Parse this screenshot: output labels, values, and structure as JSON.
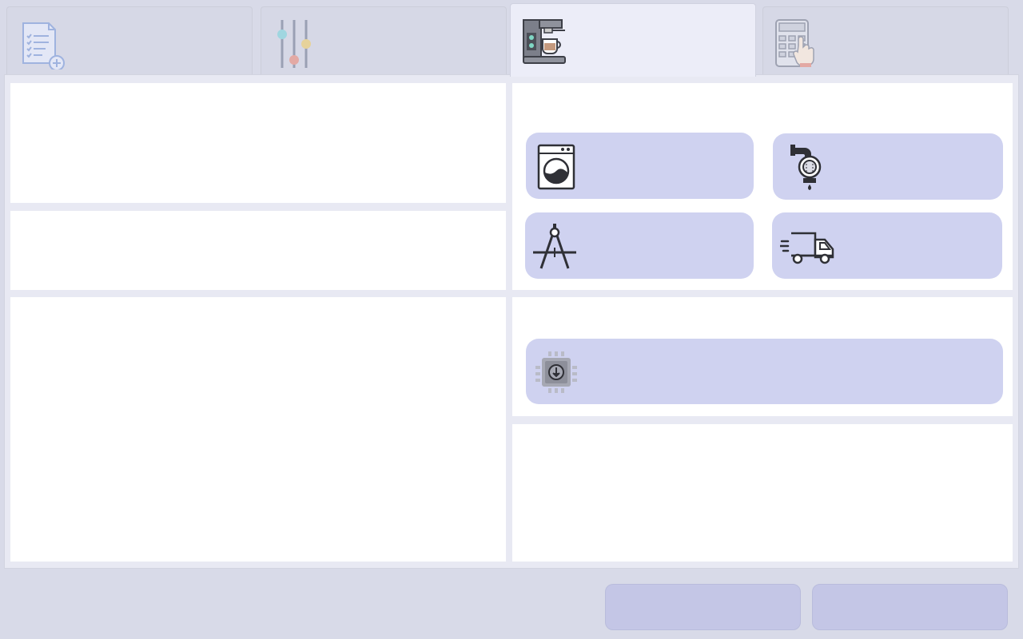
{
  "tabs": [
    {
      "label": "",
      "icon": "document-add-icon"
    },
    {
      "label": "",
      "icon": "sliders-icon"
    },
    {
      "label": "",
      "icon": "coffee-machine-icon",
      "active": true
    },
    {
      "label": "",
      "icon": "touch-keypad-icon"
    }
  ],
  "panels": {
    "left_top": {
      "title": ""
    },
    "left_middle": {
      "title": ""
    },
    "left_bottom": {
      "title": ""
    },
    "right_top": {
      "title": "",
      "buttons": [
        {
          "label": "",
          "icon": "washing-machine-icon"
        },
        {
          "label": "",
          "icon": "water-meter-icon"
        },
        {
          "label": "",
          "icon": "drafting-compass-icon"
        },
        {
          "label": "",
          "icon": "delivery-truck-icon"
        }
      ]
    },
    "right_middle": {
      "title": "",
      "buttons": [
        {
          "label": "",
          "icon": "chip-download-icon"
        }
      ]
    },
    "right_bottom": {
      "title": ""
    }
  },
  "footer": {
    "buttons": [
      {
        "label": ""
      },
      {
        "label": ""
      }
    ]
  },
  "colors": {
    "background": "#d8dae8",
    "active_tab": "#ecedf8",
    "button": "#cfd2f0",
    "footer_button": "#c4c6e6"
  }
}
